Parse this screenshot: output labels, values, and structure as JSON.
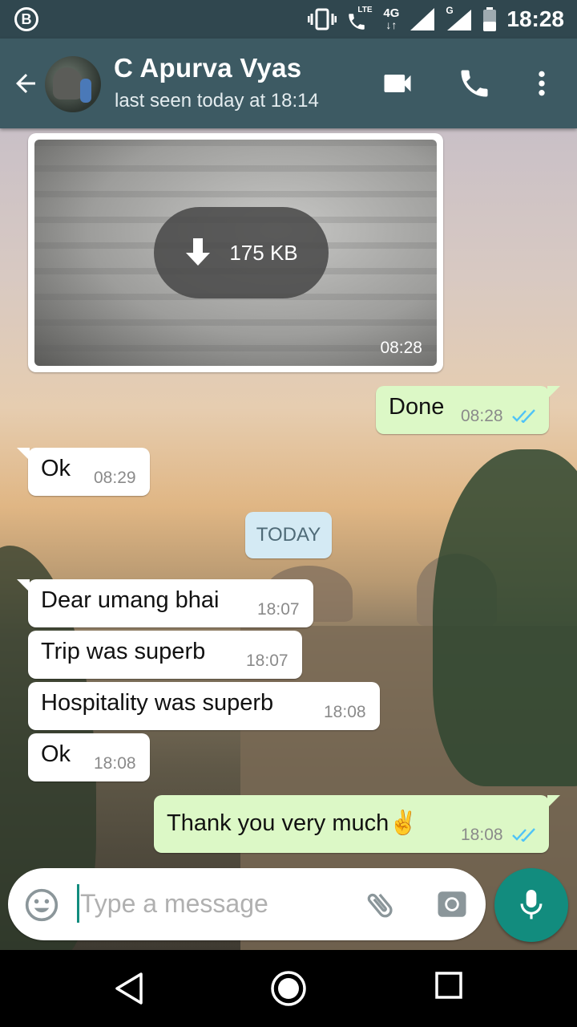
{
  "status_bar": {
    "app_badge": "B",
    "network_lte": "LTE",
    "network_4g": "4G",
    "network_g": "G",
    "time": "18:28"
  },
  "header": {
    "contact_name": "C Apurva Vyas",
    "last_seen": "last seen today at 18:14"
  },
  "messages": [
    {
      "type": "image",
      "direction": "in",
      "download_size": "175 KB",
      "time": "08:28"
    },
    {
      "type": "text",
      "direction": "out",
      "text": "Done",
      "time": "08:28",
      "status": "read"
    },
    {
      "type": "text",
      "direction": "in",
      "text": "Ok",
      "time": "08:29"
    },
    {
      "type": "date",
      "text": "TODAY"
    },
    {
      "type": "text",
      "direction": "in",
      "text": "Dear umang bhai",
      "time": "18:07"
    },
    {
      "type": "text",
      "direction": "in",
      "text": "Trip was superb",
      "time": "18:07"
    },
    {
      "type": "text",
      "direction": "in",
      "text": "Hospitality was superb",
      "time": "18:08"
    },
    {
      "type": "text",
      "direction": "in",
      "text": "Ok",
      "time": "18:08"
    },
    {
      "type": "text",
      "direction": "out",
      "text": "Thank you very much✌️",
      "time": "18:08",
      "status": "read"
    }
  ],
  "composer": {
    "placeholder": "Type a message"
  },
  "colors": {
    "header_bg": "#3d5a63",
    "status_bg": "#30474f",
    "outgoing_bubble": "#dcf8c6",
    "incoming_bubble": "#ffffff",
    "accent": "#128c7e",
    "read_ticks": "#4fc3f7"
  },
  "icons": [
    "back-arrow-icon",
    "video-call-icon",
    "phone-icon",
    "more-options-icon",
    "download-icon",
    "emoji-icon",
    "attach-icon",
    "camera-icon",
    "mic-icon",
    "nav-back-icon",
    "nav-home-icon",
    "nav-recents-icon"
  ]
}
